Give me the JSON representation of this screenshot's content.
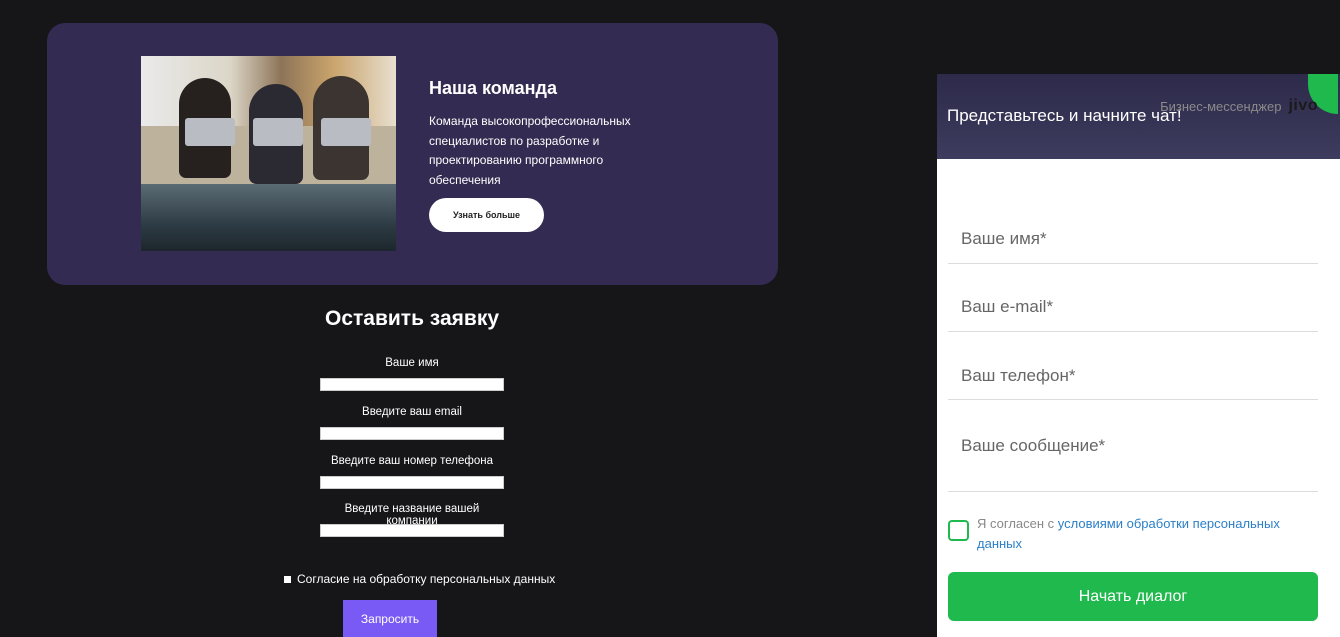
{
  "team": {
    "title": "Наша команда",
    "description": "Команда высокопрофессиональных специалистов по разработке и проектированию программного обеспечения",
    "button": "Узнать больше"
  },
  "request_form": {
    "title": "Оставить заявку",
    "fields": [
      {
        "label": "Ваше имя",
        "value": ""
      },
      {
        "label": "Введите ваш email",
        "value": ""
      },
      {
        "label": "Введите ваш номер телефона",
        "value": ""
      },
      {
        "label": "Введите название вашей компании",
        "value": ""
      }
    ],
    "consent": "Согласие на обработку персональных данных",
    "submit": "Запросить"
  },
  "chat": {
    "header": "Представьтесь и начните чат!",
    "brand_text": "Бизнес-мессенджер",
    "brand_logo": "jivo",
    "fields": [
      {
        "placeholder": "Ваше имя*"
      },
      {
        "placeholder": "Ваш e-mail*"
      },
      {
        "placeholder": "Ваш телефон*"
      },
      {
        "placeholder": "Ваше сообщение*"
      }
    ],
    "consent_prefix": "Я согласен с ",
    "consent_link": "условиями обработки персональных данных",
    "start_button": "Начать диалог"
  },
  "colors": {
    "background": "#161518",
    "card": "#332b51",
    "submit": "#7a5af5",
    "chat_green": "#1fb94e",
    "link": "#2b7fc7"
  }
}
